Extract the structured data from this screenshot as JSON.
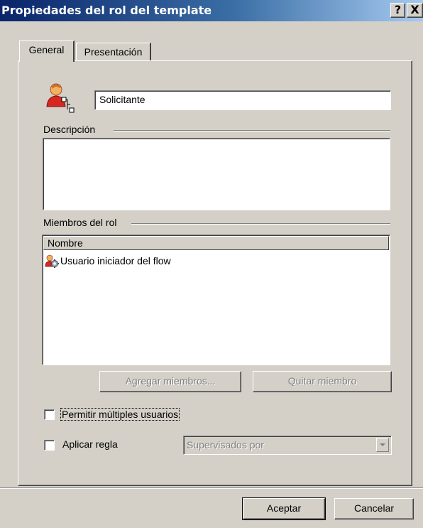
{
  "window": {
    "title": "Propiedades del rol del template",
    "help_label": "?",
    "close_label": "X"
  },
  "tabs": [
    {
      "label": "General",
      "active": true
    },
    {
      "label": "Presentación",
      "active": false
    }
  ],
  "role": {
    "icon": "role-user-icon",
    "name_value": "Solicitante"
  },
  "description": {
    "label": "Descripción",
    "value": ""
  },
  "members": {
    "label": "Miembros del rol",
    "column_header": "Nombre",
    "items": [
      {
        "icon": "user-gear-icon",
        "label": "Usuario iniciador del flow"
      }
    ],
    "add_button": "Agregar miembros...",
    "remove_button": "Quitar miembro"
  },
  "options": {
    "multiple_users_label": "Permitir múltiples usuarios",
    "multiple_users_checked": false,
    "apply_rule_label": "Aplicar regla",
    "apply_rule_checked": false,
    "rule_select_value": "Supervisados por"
  },
  "footer": {
    "ok_button": "Aceptar",
    "cancel_button": "Cancelar"
  }
}
